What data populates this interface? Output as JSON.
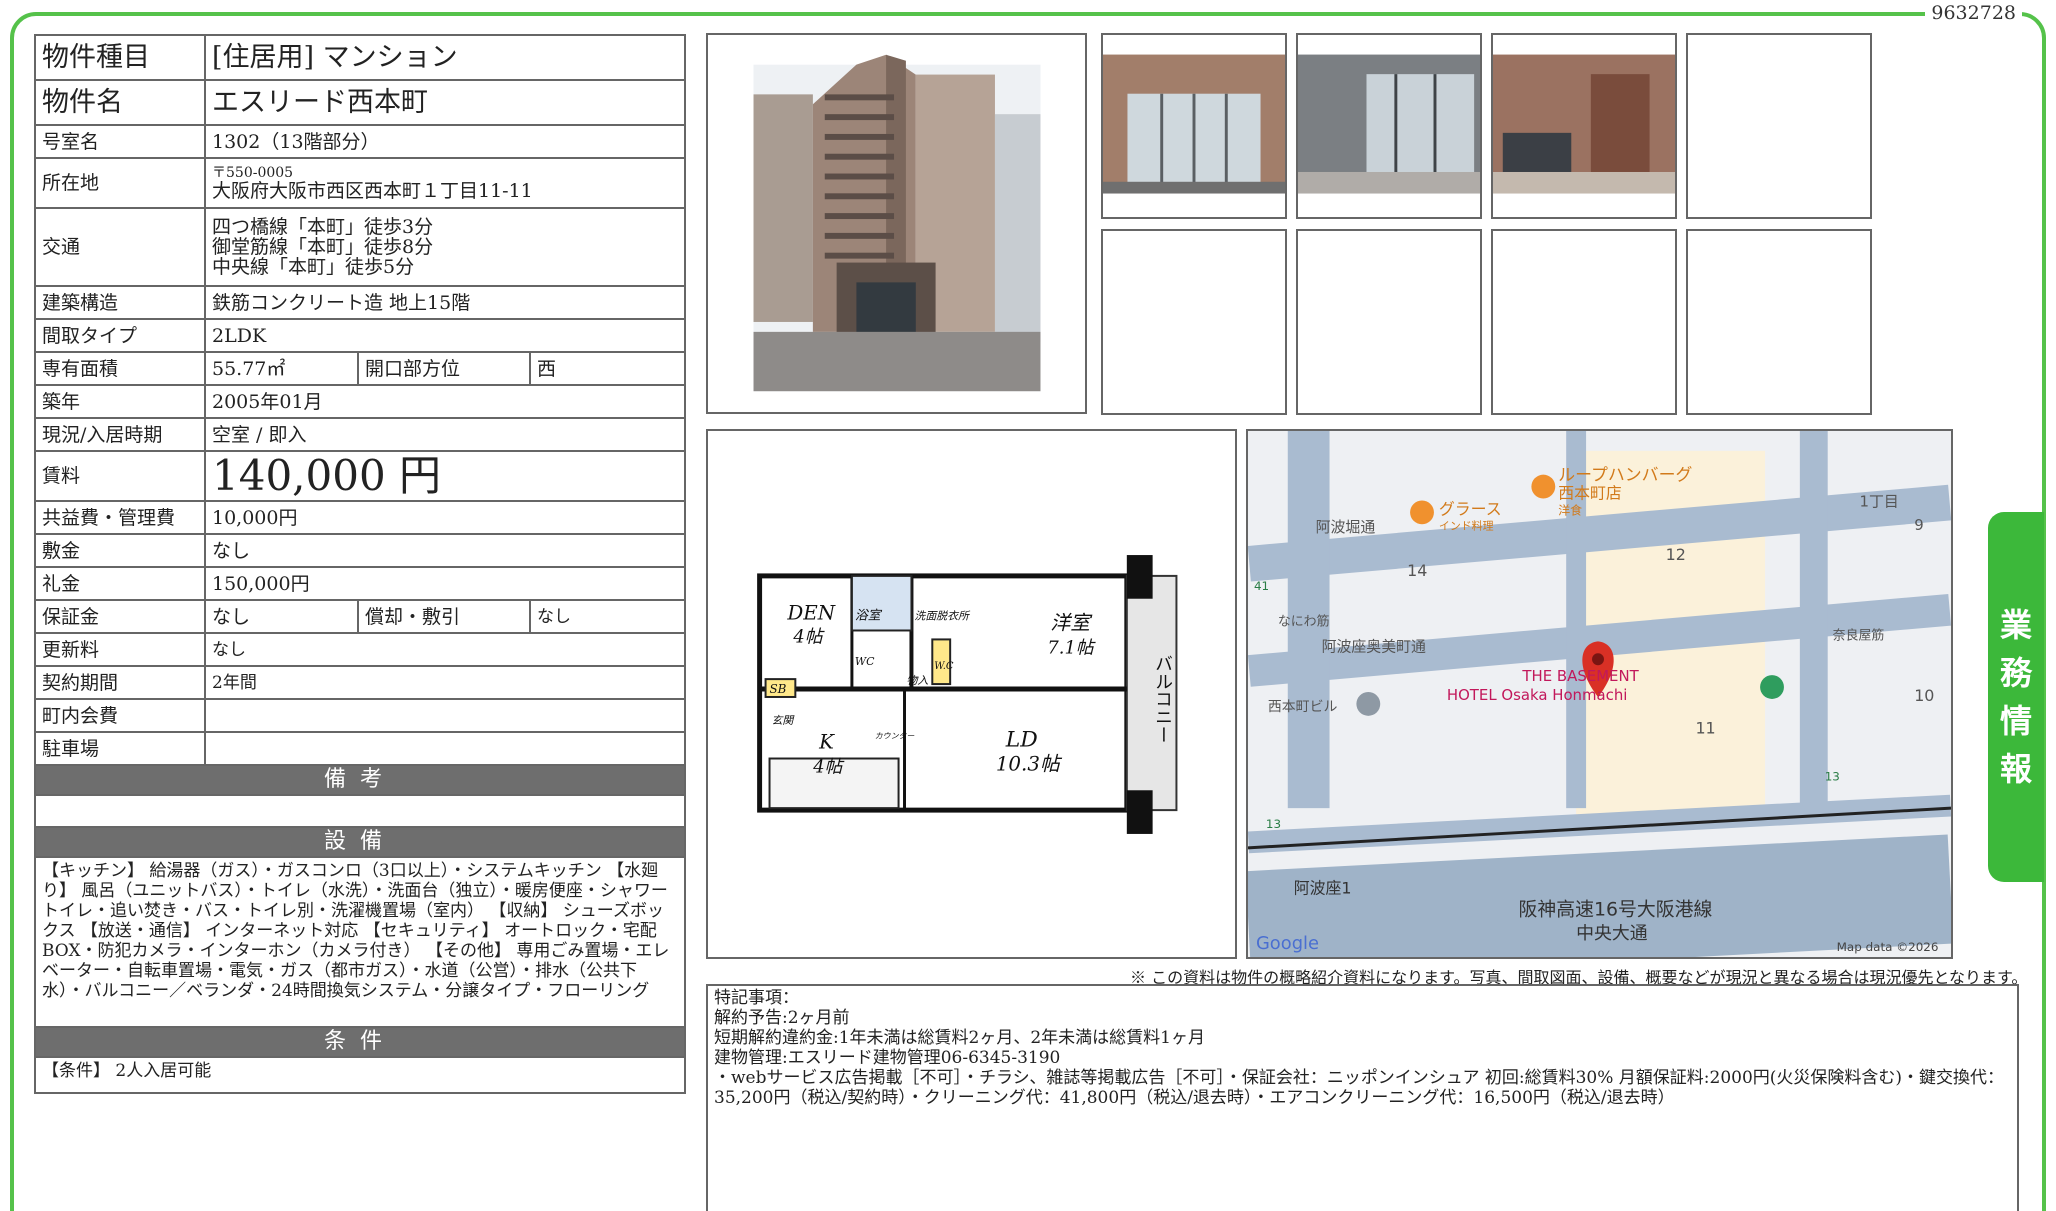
{
  "doc_id": "9632728",
  "property": {
    "type_label": "物件種目",
    "type_value": "[住居用] マンション",
    "name_label": "物件名",
    "name_value": "エスリード西本町",
    "room_label": "号室名",
    "room_value": "1302（13階部分）",
    "address_label": "所在地",
    "zip": "〒550-0005",
    "address_value": "大阪府大阪市西区西本町１丁目11-11",
    "access_label": "交通",
    "access": [
      "四つ橋線「本町」徒歩3分",
      "御堂筋線「本町」徒歩8分",
      "中央線「本町」徒歩5分"
    ],
    "structure_label": "建築構造",
    "structure_value": "鉄筋コンクリート造 地上15階",
    "layout_label": "間取タイプ",
    "layout_value": "2LDK",
    "area_label": "専有面積",
    "area_value": "55.77㎡",
    "facing_label": "開口部方位",
    "facing_value": "西",
    "built_label": "築年",
    "built_value": "2005年01月",
    "status_label": "現況/入居時期",
    "status_value": "空室 / 即入",
    "rent_label": "賃料",
    "rent_value": "140,000 円",
    "fee_label": "共益費・管理費",
    "fee_value": "10,000円",
    "deposit_label": "敷金",
    "deposit_value": "なし",
    "key_money_label": "礼金",
    "key_money_value": "150,000円",
    "guarantee_label": "保証金",
    "guarantee_value": "なし",
    "amort_label": "償却・敷引",
    "amort_value": "なし",
    "renewal_label": "更新料",
    "renewal_value": "なし",
    "contract_label": "契約期間",
    "contract_value": "2年間",
    "assoc_label": "町内会費",
    "assoc_value": "",
    "parking_label": "駐車場",
    "parking_value": ""
  },
  "sections": {
    "remarks_title": "備考",
    "remarks_text": "",
    "equipment_title": "設備",
    "equipment_text": "【キッチン】 給湯器（ガス）・ガスコンロ（3口以上）・システムキッチン 【水廻り】 風呂（ユニットバス）・トイレ（水洗）・洗面台（独立）・暖房便座・シャワートイレ・追い焚き・バス・トイレ別・洗濯機置場（室内） 【収納】 シューズボックス 【放送・通信】 インターネット対応 【セキュリティ】 オートロック・宅配BOX・防犯カメラ・インターホン（カメラ付き） 【その他】 専用ごみ置場・エレベーター・自転車置場・電気・ガス（都市ガス）・水道（公営）・排水（公共下水）・バルコニー／ベランダ・24時間換気システム・分譲タイプ・フローリング",
    "conditions_title": "条件",
    "conditions_text": "【条件】 2人入居可能"
  },
  "floorplan": {
    "rooms": [
      "DEN",
      "4帖",
      "浴室",
      "洗面脱衣所",
      "洋室",
      "7.1帖",
      "WC",
      "物入",
      "W.C",
      "SB",
      "玄関",
      "K",
      "4帖",
      "LD",
      "10.3帖",
      "カウンター",
      "バルコニー"
    ]
  },
  "map": {
    "labels": [
      "ループハンバーグ",
      "西本町店",
      "洋食",
      "グラース",
      "インド料理",
      "阿波堀通",
      "1丁目",
      "9",
      "14",
      "12",
      "41",
      "なにわ筋",
      "阿波座奥美町通",
      "THE BASEMENT",
      "HOTEL Osaka Honmachi",
      "西本町ビル",
      "11",
      "10",
      "奈良屋筋",
      "13",
      "13",
      "阿波座1",
      "阪神高速16号大阪港線",
      "中央大通",
      "Google",
      "Map data ©2026"
    ]
  },
  "disclaimer": "※ この資料は物件の概略紹介資料になります。写真、間取図面、設備、概要などが現況と異なる場合は現況優先となります。",
  "special_notes": [
    "特記事項：",
    "解約予告:2ヶ月前",
    "短期解約違約金:1年未満は総賃料2ヶ月、2年未満は総賃料1ヶ月",
    "建物管理:エスリード建物管理06-6345-3190",
    "・webサービス広告掲載［不可］・チラシ、雑誌等掲載広告［不可］・保証会社：ニッポンインシュア 初回:総賃料30% 月額保証料:2000円(火災保険料含む)・鍵交換代：35,200円（税込/契約時）・クリーニング代：41,800円（税込/退去時）・エアコンクリーニング代：16,500円（税込/退去時）"
  ],
  "side_tab": [
    "業",
    "務",
    "情",
    "報"
  ],
  "colors": {
    "frame": "#55c24a",
    "tab": "#3cb83a",
    "section_header": "#6e6e6e"
  }
}
